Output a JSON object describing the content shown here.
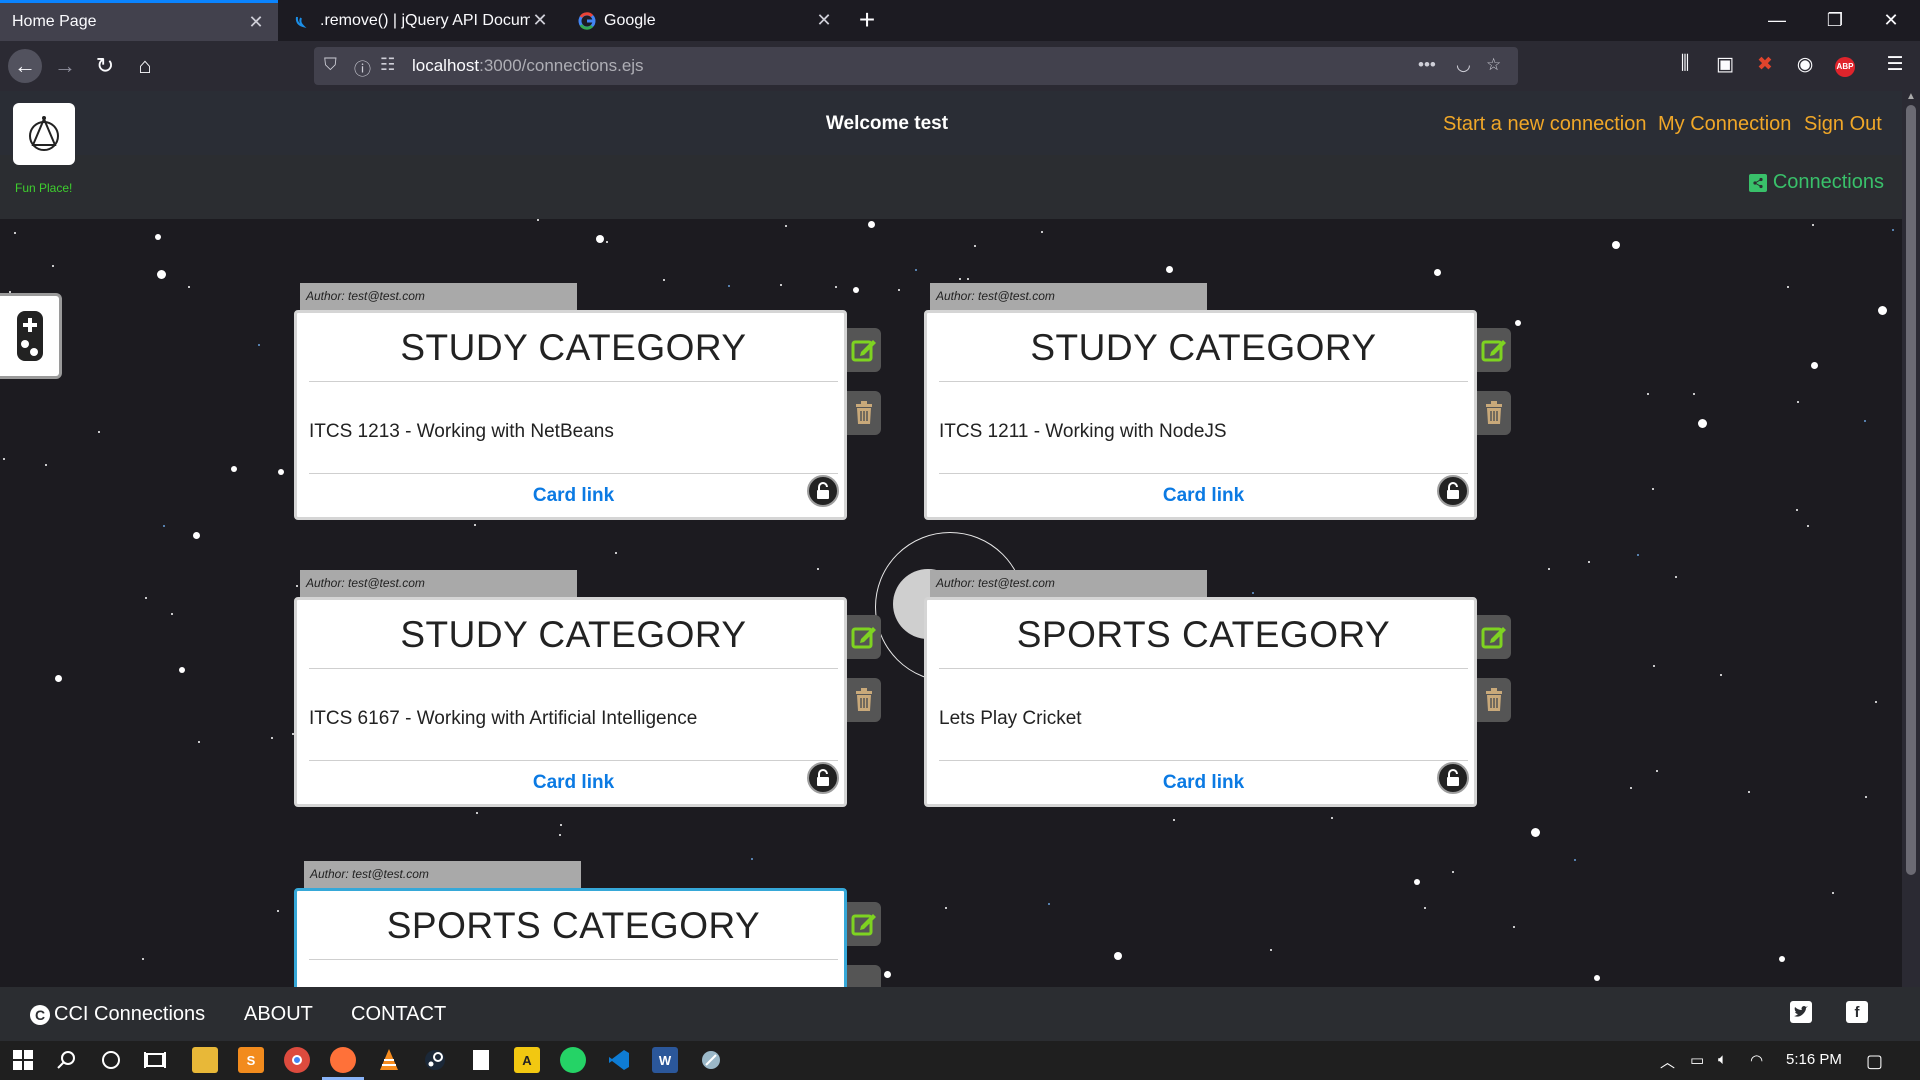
{
  "browser": {
    "tabs": [
      {
        "title": "Home Page",
        "active": true
      },
      {
        "title": ".remove() | jQuery API Documen",
        "active": false
      },
      {
        "title": "Google",
        "active": false
      }
    ],
    "url_host": "localhost",
    "url_path": ":3000/connections.ejs"
  },
  "header": {
    "logo_caption": "Fun Place!",
    "welcome": "Welcome test",
    "nav": [
      "Start a new connection",
      "My Connection",
      "Sign Out"
    ],
    "connections_link": "Connections"
  },
  "cards": [
    {
      "author": "Author: test@test.com",
      "title": "STUDY CATEGORY",
      "text": "ITCS 1213 - Working with NetBeans",
      "link": "Card link"
    },
    {
      "author": "Author: test@test.com",
      "title": "STUDY CATEGORY",
      "text": "ITCS 1211 - Working with NodeJS",
      "link": "Card link"
    },
    {
      "author": "Author: test@test.com",
      "title": "STUDY CATEGORY",
      "text": "ITCS 6167 - Working with Artificial Intelligence",
      "link": "Card link"
    },
    {
      "author": "Author: test@test.com",
      "title": "SPORTS CATEGORY",
      "text": "Lets Play Cricket",
      "link": "Card link"
    },
    {
      "author": "Author: test@test.com",
      "title": "SPORTS CATEGORY",
      "text": "",
      "link": ""
    }
  ],
  "footer": {
    "brand": "CCI Connections",
    "links": [
      "ABOUT",
      "CONTACT"
    ]
  },
  "taskbar": {
    "time": "5:16 PM"
  },
  "colors": {
    "accent_orange": "#f0a728",
    "accent_green": "#39c06a",
    "link_blue": "#0b7ae3",
    "edit_green": "#7ed321"
  }
}
